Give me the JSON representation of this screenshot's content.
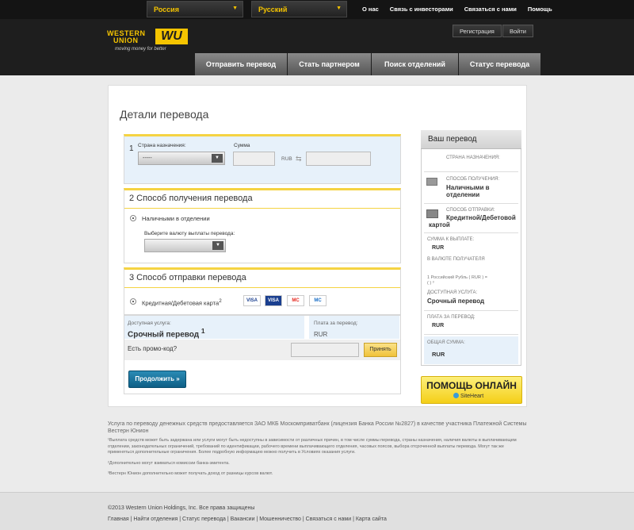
{
  "topbar": {
    "country": "Россия",
    "language": "Русский",
    "links": [
      "О нас",
      "Связь с инвесторами",
      "Связаться с нами",
      "Помощь"
    ]
  },
  "header": {
    "logo_line1": "WESTERN",
    "logo_line2": "UNION",
    "logo_mark": "WU",
    "tagline": "moving money for better",
    "register": "Регистрация",
    "login": "Войти",
    "tabs": [
      "Отправить перевод",
      "Стать партнером",
      "Поиск отделений",
      "Статус перевода"
    ]
  },
  "page": {
    "title": "Детали перевода"
  },
  "step1": {
    "number": "1",
    "country_label": "Страна назначения:",
    "country_value": "-----",
    "amount_label": "Сумма",
    "currency": "RUB",
    "swap_icon": "swap-arrows-icon"
  },
  "step2": {
    "heading": "2  Способ получения перевода",
    "option": "Наличными в отделении",
    "currency_label": "Выберите валюту выплаты перевода:"
  },
  "step3": {
    "heading": "3  Способ отправки перевода",
    "option": "Кредитная/Дебетовая карта",
    "option_sup": "2",
    "cards": [
      "VISA",
      "VISA",
      "MC",
      "MC"
    ]
  },
  "service": {
    "label": "Доступная услуга:",
    "value": "Срочный перевод",
    "value_sup": "1",
    "fee_label": "Плата за перевод:",
    "fee_value": "RUR",
    "promo_label": "Есть промо-код?",
    "accept": "Принять",
    "continue": "Продолжить »"
  },
  "summary": {
    "title": "Ваш перевод",
    "dest_label": "СТРАНА НАЗНАЧЕНИЯ:",
    "receive_label": "СПОСОБ ПОЛУЧЕНИЯ:",
    "receive_value": "Наличными в отделении",
    "send_label": "СПОСОБ ОТПРАВКИ:",
    "send_value": "Кредитной/Дебетовой картой",
    "payout_label": "СУММА К ВЫПЛАТЕ:",
    "payout_value": "RUR",
    "recv_currency_label": "В ВАЛЮТЕ ПОЛУЧАТЕЛЯ",
    "rate_text": "1 Российский Рубль ( RUR ) =",
    "rate_text2": "( ) ³",
    "service_label": "ДОСТУПНАЯ УСЛУГА:",
    "service_value": "Срочный перевод",
    "fee_label": "ПЛАТА ЗА ПЕРЕВОД:",
    "fee_value": "RUR",
    "total_label": "ОБЩАЯ СУММА:",
    "total_value": "RUR"
  },
  "help": {
    "title": "ПОМОЩЬ ОНЛАЙН",
    "brand": "SiteHeart"
  },
  "disclaimer": {
    "main": "Услуга по переводу денежных средств предоставляется ЗАО МКБ Москомприватбанк (лицензия Банка России №2827) в качестве участника Платежной Системы Вестерн Юнион",
    "note1": "¹Выплата средств может быть задержана или услуги могут быть недоступны в зависимости от различных причин, в том числе суммы перевода, страны назначения, наличия валюты в выплачивающем отделении, законодательных ограничений, требований по идентификации, рабочего времени выплачивающего отделения, часовых поясов, выбора отсроченной выплаты перевода. Могут так же применяться дополнительные ограничения. Более подробную информацию можно получить в Условиях оказания услуги.",
    "note2": "²Дополнительно могут взиматься комиссии банка-эмитента.",
    "note3": "³Вестерн Юнион дополнительно может получать доход от разницы курсов валют."
  },
  "footer": {
    "copyright": "©2013 Western Union Holdings, Inc. Все права защищены",
    "links": [
      "Главная",
      "Найти отделения",
      "Статус перевода",
      "Вакансии",
      "Мошенничество",
      "Связаться с нами",
      "Карта сайта"
    ]
  }
}
